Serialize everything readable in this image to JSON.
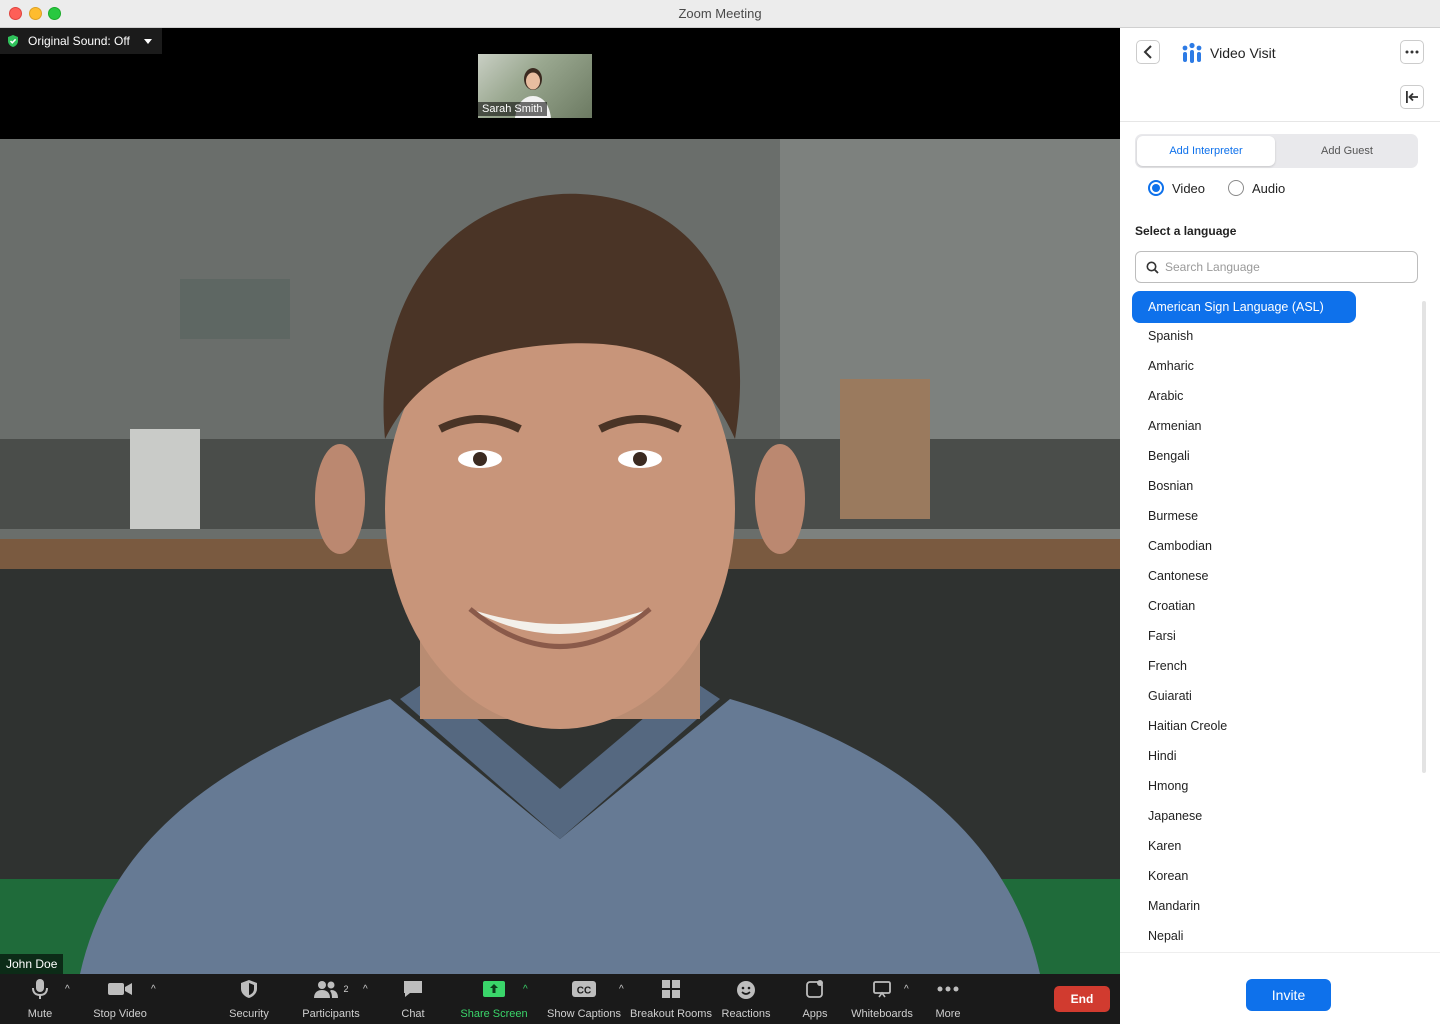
{
  "window": {
    "title": "Zoom Meeting"
  },
  "top_bar": {
    "original_sound_label": "Original Sound: Off"
  },
  "participants": {
    "thumbnail_name": "Sarah Smith",
    "main_name": "John Doe"
  },
  "toolbar": {
    "mute": "Mute",
    "stop_video": "Stop Video",
    "security": "Security",
    "participants": "Participants",
    "participants_count": "2",
    "chat": "Chat",
    "share_screen": "Share Screen",
    "show_captions": "Show Captions",
    "breakout_rooms": "Breakout Rooms",
    "reactions": "Reactions",
    "apps": "Apps",
    "whiteboards": "Whiteboards",
    "more": "More",
    "end": "End"
  },
  "panel": {
    "title": "Video Visit",
    "tabs": {
      "add_interpreter": "Add Interpreter",
      "add_guest": "Add Guest"
    },
    "mode": {
      "video": "Video",
      "audio": "Audio",
      "selected": "video"
    },
    "language_heading": "Select a language",
    "search_placeholder": "Search Language",
    "languages": [
      "American Sign Language (ASL)",
      "Spanish",
      "Amharic",
      "Arabic",
      "Armenian",
      "Bengali",
      "Bosnian",
      "Burmese",
      "Cambodian",
      "Cantonese",
      "Croatian",
      "Farsi",
      "French",
      "Guiarati",
      "Haitian Creole",
      "Hindi",
      "Hmong",
      "Japanese",
      "Karen",
      "Korean",
      "Mandarin",
      "Nepali"
    ],
    "selected_language": "American Sign Language (ASL)",
    "invite": "Invite"
  },
  "colors": {
    "accent": "#0e71eb",
    "end_button": "#d13b2f",
    "share_green": "#3ad56a"
  }
}
